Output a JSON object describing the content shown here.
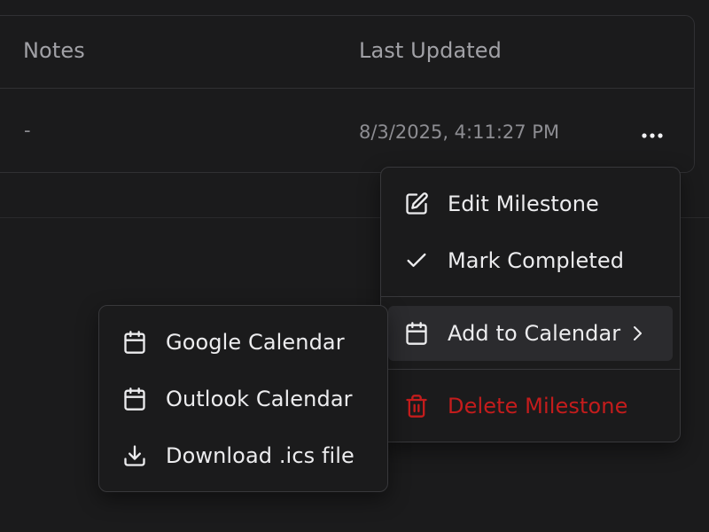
{
  "table": {
    "columns": {
      "notes": "Notes",
      "last_updated": "Last Updated"
    },
    "rows": [
      {
        "notes": "-",
        "last_updated": "8/3/2025, 4:11:27 PM"
      }
    ]
  },
  "row_menu": {
    "items": [
      {
        "label": "Edit Milestone",
        "icon": "edit-icon"
      },
      {
        "label": "Mark Completed",
        "icon": "check-icon"
      },
      {
        "label": "Add to Calendar",
        "icon": "calendar-icon",
        "has_submenu": true,
        "active": true
      },
      {
        "label": "Delete Milestone",
        "icon": "trash-icon",
        "danger": true
      }
    ]
  },
  "calendar_submenu": {
    "items": [
      {
        "label": "Google Calendar",
        "icon": "calendar-icon"
      },
      {
        "label": "Outlook Calendar",
        "icon": "calendar-icon"
      },
      {
        "label": "Download .ics file",
        "icon": "download-icon"
      }
    ]
  },
  "colors": {
    "background": "#1b1b1c",
    "border": "#303033",
    "danger": "#c41c1c",
    "active_item": "#2b2b2e"
  }
}
